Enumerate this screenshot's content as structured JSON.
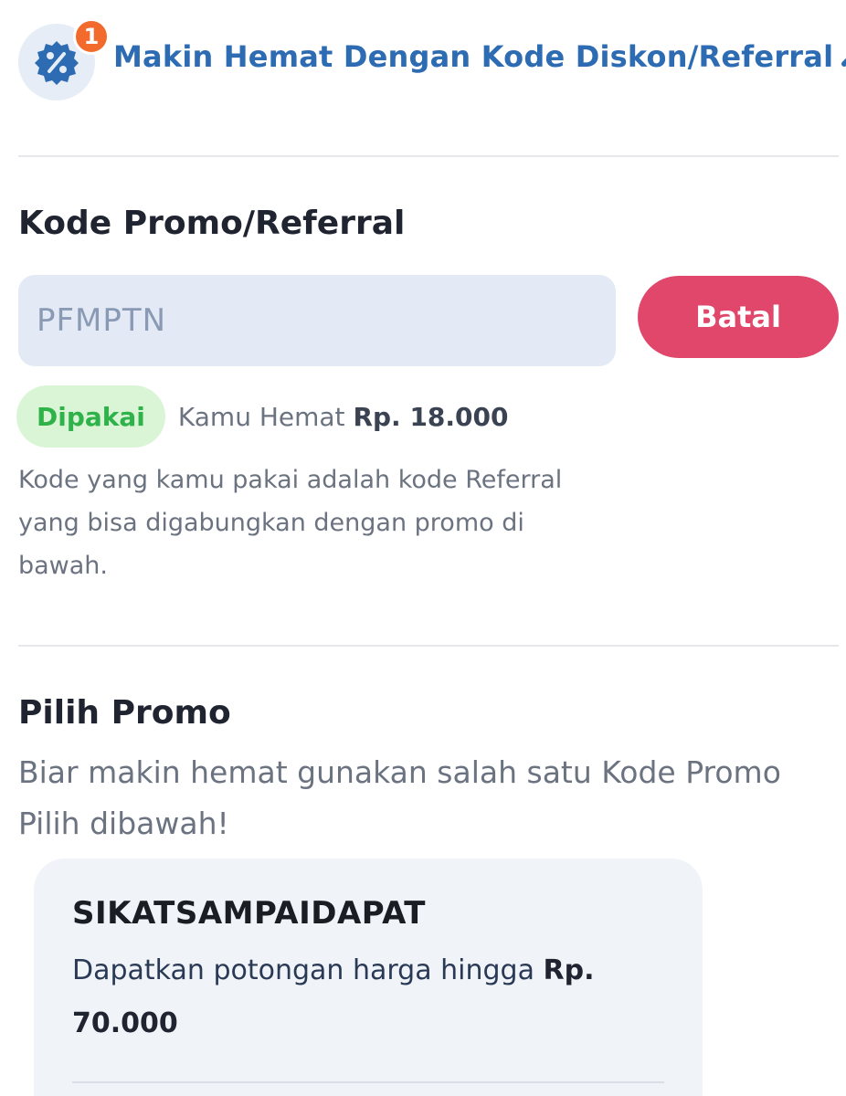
{
  "header": {
    "badge_count": "1",
    "title": "Makin Hemat Dengan Kode Diskon/Referral",
    "icon": "discount-badge-icon",
    "chevron_icon": "chevron-up-icon",
    "accent_color": "#2d6bb3",
    "badge_color": "#f26b2c"
  },
  "promo_section": {
    "title": "Kode Promo/Referral",
    "input_value": "PFMPTN",
    "cancel_label": "Batal",
    "cancel_color": "#e0476b",
    "status_label": "Dipakai",
    "saving_prefix": "Kamu Hemat",
    "saving_amount": "Rp. 18.000",
    "note": "Kode yang kamu pakai adalah kode Referral yang bisa digabungkan dengan promo di bawah."
  },
  "pilih_section": {
    "title": "Pilih Promo",
    "subtitle": "Biar makin hemat gunakan salah satu Kode Promo Pilih dibawah!",
    "cards": [
      {
        "code": "SIKATSAMPAIDAPAT",
        "desc_prefix": "Dapatkan potongan harga hingga",
        "desc_amount": "Rp. 70.000"
      }
    ]
  }
}
